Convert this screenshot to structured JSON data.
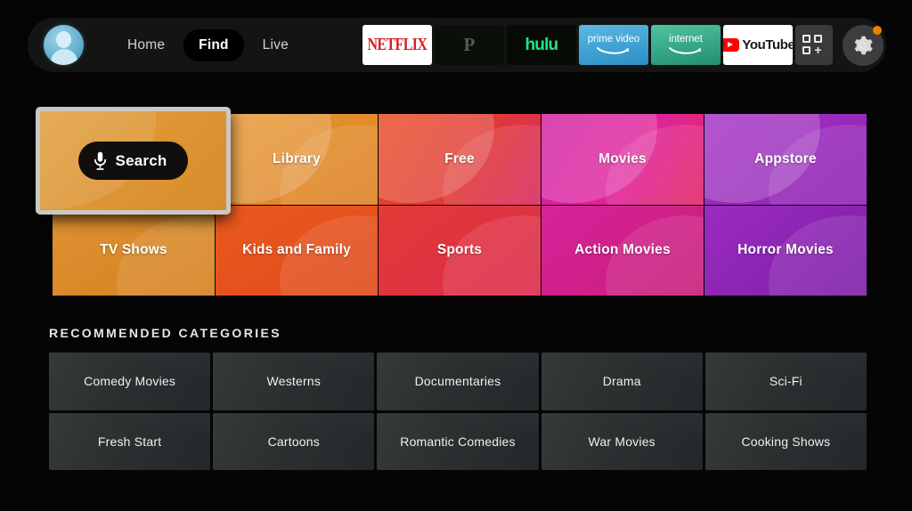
{
  "topbar": {
    "avatar_name": "user-avatar",
    "nav": [
      {
        "label": "Home",
        "active": false
      },
      {
        "label": "Find",
        "active": true
      },
      {
        "label": "Live",
        "active": false
      }
    ],
    "apps": [
      {
        "name": "netflix",
        "label": "NETFLIX"
      },
      {
        "name": "peacock",
        "label": "P"
      },
      {
        "name": "hulu",
        "label": "hulu"
      },
      {
        "name": "prime-video",
        "label_top": "prime video"
      },
      {
        "name": "internet",
        "label_top": "internet"
      },
      {
        "name": "youtube",
        "label": "YouTube"
      }
    ],
    "apps_grid_label": "+",
    "settings_label": "Settings",
    "notification_dot_color": "#f08000"
  },
  "main_tiles": {
    "search": {
      "label": "Search",
      "icon": "microphone-icon",
      "focused": true,
      "color": "#dd9433"
    },
    "row1": [
      {
        "label": "Library",
        "color": "#e08b2e",
        "gradient": "linear-gradient(150deg,#e6962f 0%,#de8228 100%)"
      },
      {
        "label": "Free",
        "color": "#e8491f",
        "gradient": "linear-gradient(120deg,#e8491f 0%,#e03a36 55%,#d92a63 100%)"
      },
      {
        "label": "Movies",
        "color": "#d61fa0",
        "gradient": "linear-gradient(120deg,#cf1f9e 0%,#e0229f 50%,#e02a66 100%)"
      },
      {
        "label": "Appstore",
        "color": "#9b2bbf",
        "gradient": "linear-gradient(140deg,#a42fc4 0%,#8f26b3 100%)"
      }
    ],
    "row2": [
      {
        "label": "TV Shows",
        "color": "#d98a2b",
        "gradient": "linear-gradient(150deg,#df9133 0%,#d4821f 100%)"
      },
      {
        "label": "Kids and Family",
        "color": "#e6541f",
        "gradient": "linear-gradient(150deg,#ea5a1e 0%,#e04a1d 100%)"
      },
      {
        "label": "Sports",
        "color": "#e0333d",
        "gradient": "linear-gradient(140deg,#e33a36 0%,#dc2b4c 100%)"
      },
      {
        "label": "Action Movies",
        "color": "#d41f86",
        "gradient": "linear-gradient(140deg,#d8219a 0%,#c81f78 100%)"
      },
      {
        "label": "Horror Movies",
        "color": "#8b23b5",
        "gradient": "linear-gradient(140deg,#9b2bbf 0%,#7d1fa8 100%)"
      }
    ]
  },
  "recommended": {
    "title": "RECOMMENDED CATEGORIES",
    "items": [
      "Comedy Movies",
      "Westerns",
      "Documentaries",
      "Drama",
      "Sci-Fi",
      "Fresh Start",
      "Cartoons",
      "Romantic Comedies",
      "War Movies",
      "Cooking Shows"
    ]
  }
}
